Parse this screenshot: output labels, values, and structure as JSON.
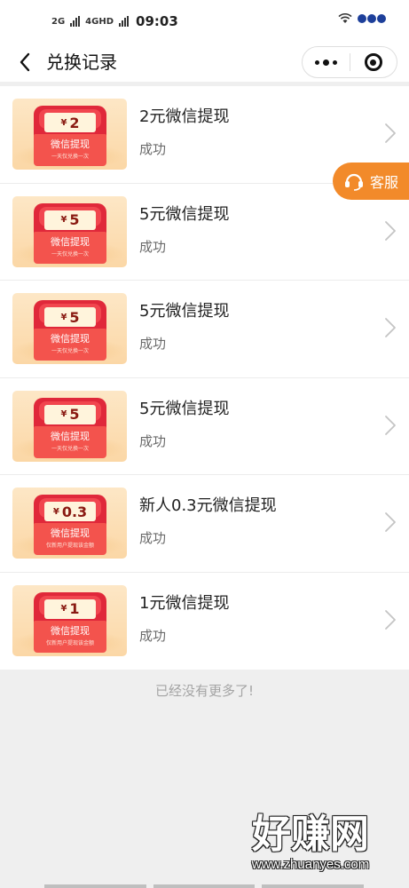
{
  "status_bar": {
    "signal_1": "2G",
    "signal_2": "4GHD",
    "time": "09:03"
  },
  "nav": {
    "title": "兑换记录"
  },
  "records": [
    {
      "thumb_amount": "2",
      "thumb_title": "微信提现",
      "thumb_sub": "一天仅兑换一次",
      "title": "2元微信提现",
      "status": "成功"
    },
    {
      "thumb_amount": "5",
      "thumb_title": "微信提现",
      "thumb_sub": "一天仅兑换一次",
      "title": "5元微信提现",
      "status": "成功"
    },
    {
      "thumb_amount": "5",
      "thumb_title": "微信提现",
      "thumb_sub": "一天仅兑换一次",
      "title": "5元微信提现",
      "status": "成功"
    },
    {
      "thumb_amount": "5",
      "thumb_title": "微信提现",
      "thumb_sub": "一天仅兑换一次",
      "title": "5元微信提现",
      "status": "成功"
    },
    {
      "thumb_amount": "0.3",
      "thumb_title": "微信提现",
      "thumb_sub": "仅新用户提现该金额",
      "title": "新人0.3元微信提现",
      "status": "成功"
    },
    {
      "thumb_amount": "1",
      "thumb_title": "微信提现",
      "thumb_sub": "仅新用户提现该金额",
      "title": "1元微信提现",
      "status": "成功"
    }
  ],
  "currency_symbol": "¥",
  "service_button": {
    "label": "客服"
  },
  "end_text": "已经没有更多了!",
  "watermark": {
    "main": "好赚网",
    "url": "www.zhuanyes.com"
  },
  "colors": {
    "accent": "#f28a2a",
    "envelope_red": "#e0283a"
  }
}
